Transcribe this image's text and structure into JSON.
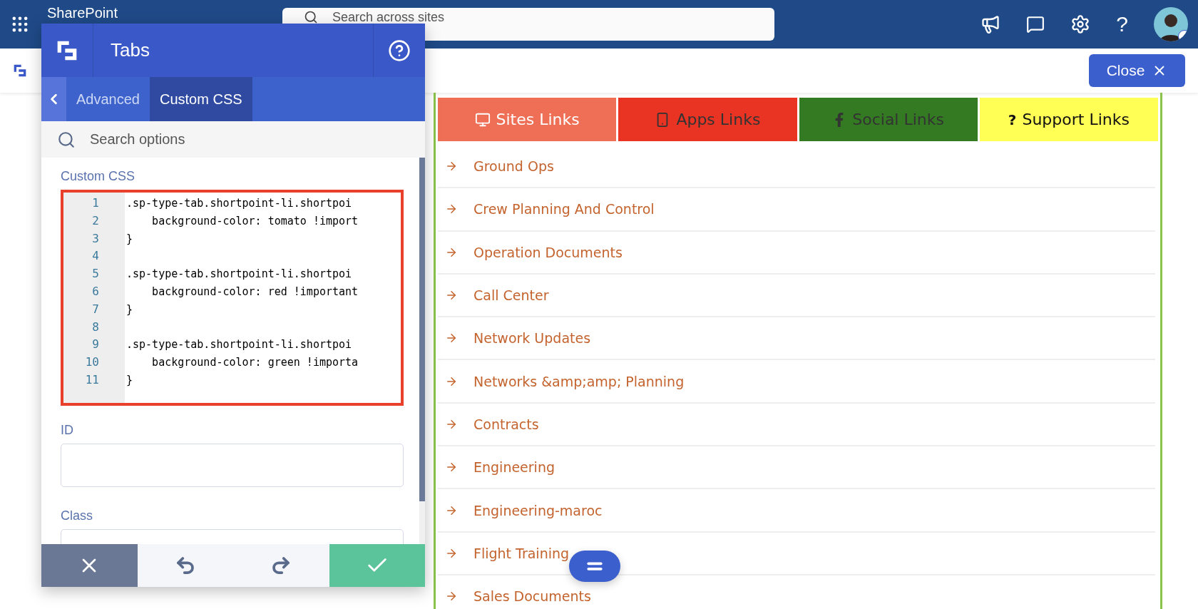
{
  "top_bar": {
    "app_name": "SharePoint",
    "search": {
      "placeholder": "Search across sites"
    },
    "help_glyph": "?"
  },
  "close_button": {
    "label": "Close"
  },
  "panel": {
    "title": "Tabs",
    "tabs": [
      {
        "label": "Advanced",
        "selected": false
      },
      {
        "label": "Custom CSS",
        "selected": true
      }
    ],
    "search": {
      "placeholder": "Search options"
    },
    "css_field": {
      "label": "Custom CSS",
      "highlighted": true,
      "lines": [
        {
          "number": "1",
          "code": ".sp-type-tab.shortpoint-li.shortpoi"
        },
        {
          "number": "2",
          "code": "    background-color: tomato !import"
        },
        {
          "number": "3",
          "code": "}"
        },
        {
          "number": "4"
        },
        {
          "number": "5",
          "code": ".sp-type-tab.shortpoint-li.shortpoi"
        },
        {
          "number": "6",
          "code": "    background-color: red !important"
        },
        {
          "number": "7",
          "code": "}"
        },
        {
          "number": "8"
        },
        {
          "number": "9",
          "code": ".sp-type-tab.shortpoint-li.shortpoi"
        },
        {
          "number": "10",
          "code": "    background-color: green !importa"
        },
        {
          "number": "11",
          "code": "}"
        }
      ]
    },
    "fields": [
      {
        "label": "ID"
      },
      {
        "label": "Class"
      }
    ]
  },
  "link_tabs": [
    {
      "label": "Sites Links",
      "color": "#ee6f55"
    },
    {
      "label": "Apps Links",
      "color": "#e93424"
    },
    {
      "label": "Social Links",
      "color": "#347a22"
    },
    {
      "label": "Support Links",
      "color": "#ffff55",
      "glyph": "?"
    }
  ],
  "links": [
    "Ground Ops",
    "Crew Planning And Control",
    "Operation Documents",
    "Call Center",
    "Network Updates",
    "Networks &amp;amp; Planning",
    "Contracts",
    "Engineering",
    "Engineering-maroc",
    "Flight Training",
    "Sales Documents"
  ]
}
